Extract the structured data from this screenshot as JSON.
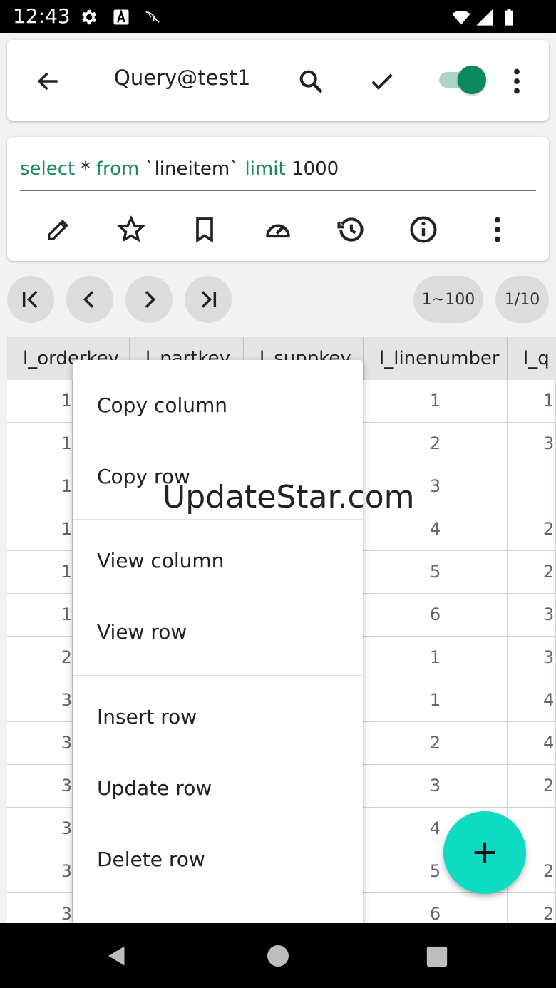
{
  "status_bar": {
    "time": "12:43"
  },
  "topbar": {
    "title": "Query@test1",
    "toggle_on": true
  },
  "editor": {
    "sql_tokens": [
      {
        "text": "select",
        "kw": true
      },
      {
        "text": " * ",
        "kw": false
      },
      {
        "text": "from",
        "kw": true
      },
      {
        "text": " `lineitem` ",
        "kw": false
      },
      {
        "text": "limit",
        "kw": true
      },
      {
        "text": " 1000",
        "kw": false
      }
    ],
    "toolbar_icons": [
      "edit-icon",
      "star-icon",
      "bookmark-icon",
      "speed-icon",
      "history-icon",
      "info-icon",
      "more-vert-icon"
    ]
  },
  "pagination": {
    "range": "1~100",
    "page": "1/10"
  },
  "table": {
    "columns": [
      "l_orderkey",
      "l_partkey",
      "l_suppkey",
      "l_linenumber",
      "l_q"
    ],
    "rows": [
      [
        "1",
        "1",
        "1"
      ],
      [
        "1",
        "2",
        "3"
      ],
      [
        "1",
        "3",
        ""
      ],
      [
        "1",
        "4",
        "2"
      ],
      [
        "1",
        "5",
        "2"
      ],
      [
        "1",
        "6",
        "3"
      ],
      [
        "2",
        "1",
        "3"
      ],
      [
        "3",
        "1",
        "4"
      ],
      [
        "3",
        "2",
        "4"
      ],
      [
        "3",
        "3",
        "2"
      ],
      [
        "3",
        "4",
        ""
      ],
      [
        "3",
        "5",
        "2"
      ],
      [
        "3",
        "6",
        "2"
      ]
    ]
  },
  "context_menu": {
    "items": [
      "Copy column",
      "Copy row",
      "View column",
      "View row",
      "Insert row",
      "Update row",
      "Delete row"
    ]
  },
  "watermark": "UpdateStar.com",
  "colors": {
    "accent": "#0b8a5f",
    "keyword": "#1a8a5a",
    "fab": "#0ddcc2"
  }
}
